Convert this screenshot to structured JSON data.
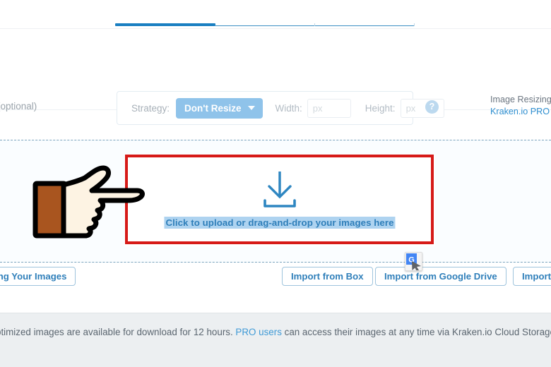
{
  "tabs": {
    "active_index": 0,
    "items": [
      {
        "label": "",
        "name": "tab-web-interface",
        "active": true
      },
      {
        "label": "",
        "name": "tab-second",
        "active": false
      },
      {
        "label": "",
        "name": "tab-third",
        "active": false
      }
    ]
  },
  "options": {
    "optional_label": "(optional)",
    "strategy_label": "Strategy:",
    "strategy_value": "Don't Resize",
    "strategy_caret": "chevron-down-icon",
    "width_label": "Width:",
    "width_value": "",
    "width_placeholder": "px",
    "height_label": "Height:",
    "height_value": "",
    "height_placeholder": "px",
    "help_icon": "?",
    "pro_note_line1": "Image Resizing i",
    "pro_note_link": "Kraken.io PRO"
  },
  "dropzone": {
    "icon": "download-icon",
    "text": "Click to upload or drag-and-drop your images here",
    "highlight_color": "#aed3f0",
    "text_color": "#2f7fba",
    "annotation_color": "#d61a18",
    "cursor": "pointing-hand"
  },
  "buttons": {
    "retaining": "aining Your Images",
    "import_box": "Import from Box",
    "import_gdrive": "Import from Google Drive",
    "import_dropbox": "Import f"
  },
  "extension": {
    "badge": "google-translate-icon",
    "badge_letter": "G"
  },
  "footer": {
    "text_before": "ptimized images are available for download for 12 hours. ",
    "link": "PRO users",
    "text_after": " can access their images at any time via Kraken.io Cloud Storage."
  },
  "colors": {
    "accent_blue": "#2f8fd0",
    "tab_active": "#1a7fc1",
    "strategy_bg": "#8fc3ea",
    "annotation_red": "#d61a18",
    "footer_bg": "#eceff1",
    "dropzone_bg": "#fafdff",
    "hand_skin": "#fdf3e3",
    "hand_cuff": "#a9551f"
  }
}
